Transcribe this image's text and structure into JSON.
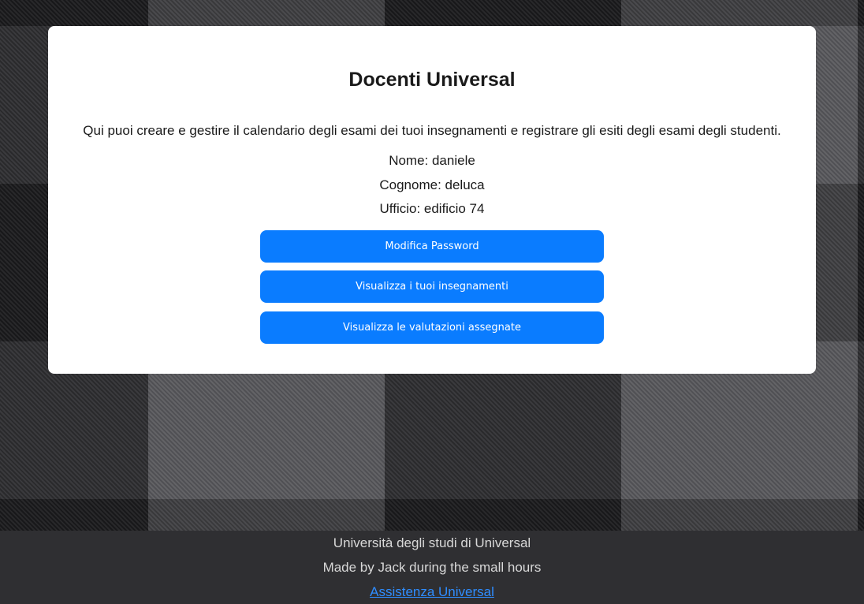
{
  "card": {
    "title": "Docenti Universal",
    "intro": "Qui puoi creare e gestire il calendario degli esami dei tuoi insegnamenti e registrare gli esiti degli esami degli studenti.",
    "info": {
      "name": "Nome: daniele",
      "surname": "Cognome: deluca",
      "office": "Ufficio: edificio 74"
    },
    "buttons": {
      "change_password": "Modifica Password",
      "view_courses": "Visualizza i tuoi insegnamenti",
      "view_grades": "Visualizza le valutazioni assegnate"
    }
  },
  "footer": {
    "university": "Università degli studi di Universal",
    "made_by": "Made by Jack during the small hours",
    "support_link": "Assistenza Universal"
  },
  "colors": {
    "button": "#0a7cff",
    "footer_bg": "#2f2f32",
    "link": "#2f8dff"
  }
}
